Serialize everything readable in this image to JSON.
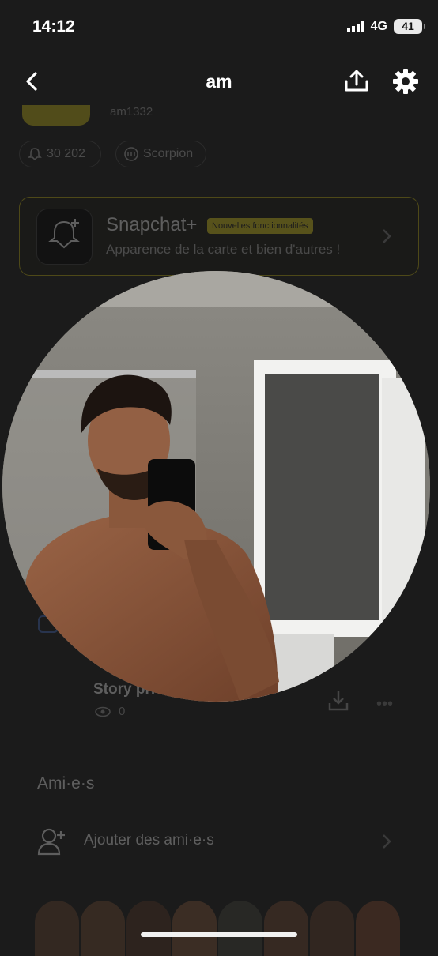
{
  "status_bar": {
    "time": "14:12",
    "network": "4G",
    "battery": "41"
  },
  "header": {
    "title": "am"
  },
  "profile": {
    "username": "am1332",
    "score": "30 202",
    "zodiac": "Scorpion"
  },
  "snapchat_plus": {
    "title": "Snapchat+",
    "badge": "Nouvelles fonctionnalités",
    "subtitle": "Apparence de la carte et bien d'autres !"
  },
  "story": {
    "title": "Story pri",
    "views": "0"
  },
  "friends": {
    "heading": "Ami·e·s",
    "add_label": "Ajouter des ami·e·s"
  },
  "colors": {
    "accent": "#e8d51e",
    "background": "#1b1b1b"
  }
}
